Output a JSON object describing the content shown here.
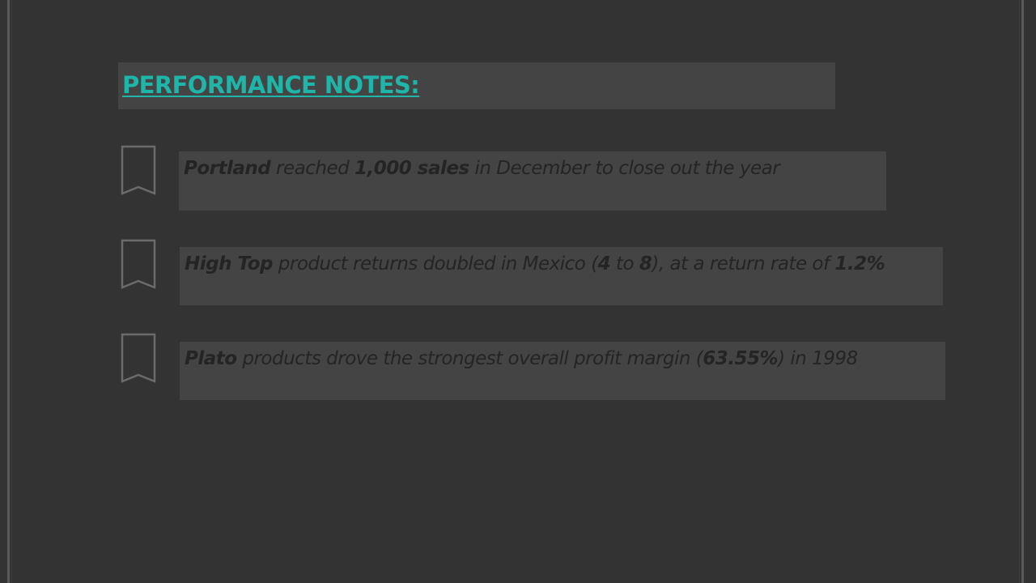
{
  "title": "PERFORMANCE NOTES:",
  "colors": {
    "background": "#333333",
    "box": "#444444",
    "accent": "#1fb5a8",
    "note_text": "#242424",
    "bookmark_stroke": "#6b6b6b"
  },
  "icons": [
    "bookmark-icon",
    "bookmark-icon",
    "bookmark-icon"
  ],
  "notes": [
    {
      "p1": "Portland",
      "p2": " reached ",
      "p3": "1,000 sales",
      "p4": " in December to close out the year"
    },
    {
      "p1": "High Top",
      "p2": " product returns doubled in Mexico (",
      "p3": "4",
      "p4": " to ",
      "p5": "8",
      "p6": "), at a return rate of ",
      "p7": "1.2%"
    },
    {
      "p1": "Plato",
      "p2": " products drove the strongest overall profit margin (",
      "p3": "63.55%",
      "p4": ") in 1998"
    }
  ]
}
